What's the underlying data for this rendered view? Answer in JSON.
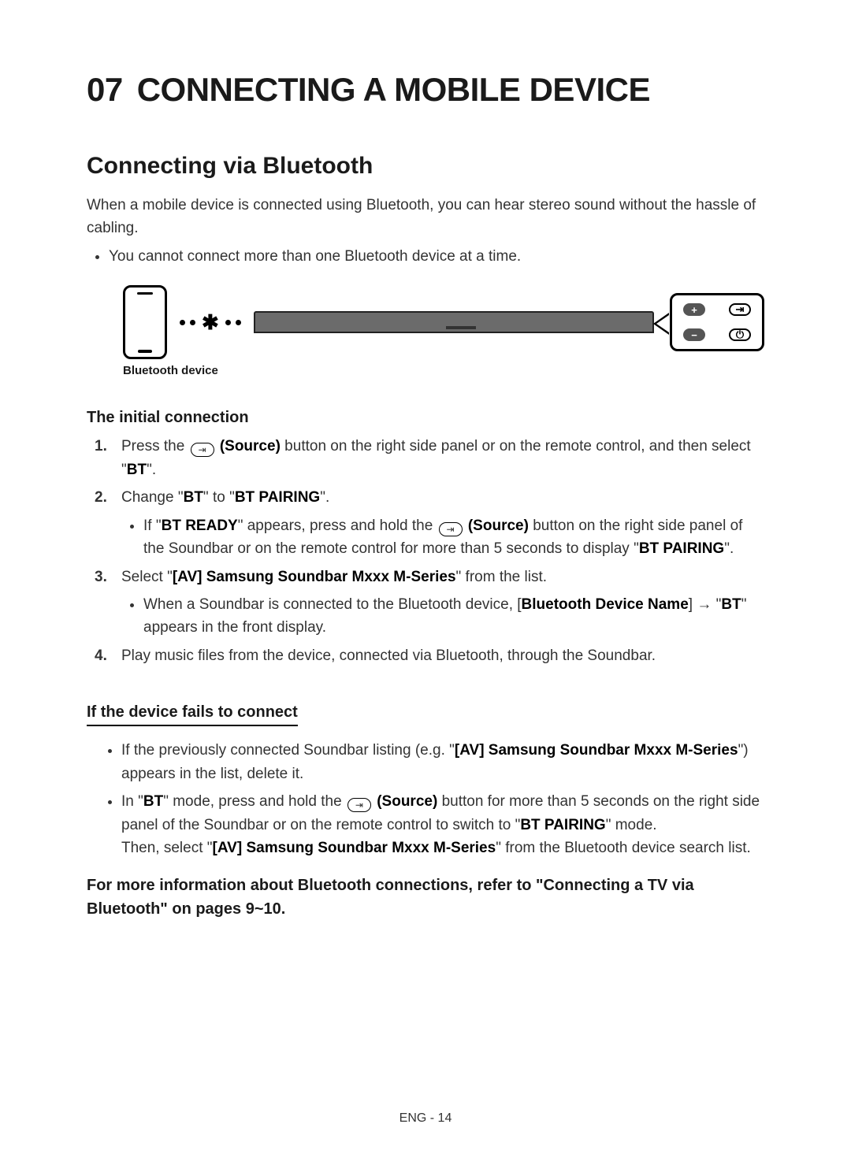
{
  "chapter": {
    "num": "07",
    "title": "CONNECTING A MOBILE DEVICE"
  },
  "section_title": "Connecting via Bluetooth",
  "intro": "When a mobile device is connected using Bluetooth, you can hear stereo sound without the hassle of cabling.",
  "intro_bullet": "You cannot connect more than one Bluetooth device at a time.",
  "illus_caption": "Bluetooth device",
  "h3_initial": "The initial connection",
  "steps": {
    "s1": {
      "num": "1.",
      "a": "Press the ",
      "b": " (Source)",
      "c": " button on the right side panel or on the remote control, and then select \"",
      "d": "BT",
      "e": "\"."
    },
    "s2": {
      "num": "2.",
      "a": "Change \"",
      "b": "BT",
      "c": "\" to \"",
      "d": "BT PAIRING",
      "e": "\".",
      "sub": {
        "a": "If \"",
        "b": "BT READY",
        "c": "\" appears, press and hold the ",
        "d": " (Source)",
        "e": " button on the right side panel of the Soundbar or on the remote control for more than 5 seconds to display \"",
        "f": "BT PAIRING",
        "g": "\"."
      }
    },
    "s3": {
      "num": "3.",
      "a": "Select \"",
      "b": "[AV] Samsung Soundbar Mxxx M-Series",
      "c": "\" from the list.",
      "sub": {
        "a": "When a Soundbar is connected to the Bluetooth device, [",
        "b": "Bluetooth Device Name",
        "c": "] → \"",
        "d": "BT",
        "e": "\" appears in the front display."
      }
    },
    "s4": {
      "num": "4.",
      "text": "Play music files from the device, connected via Bluetooth, through the Soundbar."
    }
  },
  "h3_fail": "If the device fails to connect",
  "fail": {
    "b1": {
      "a": "If the previously connected Soundbar listing (e.g. \"",
      "b": "[AV] Samsung Soundbar Mxxx M-Series",
      "c": "\") appears in the list, delete it."
    },
    "b2": {
      "a": "In \"",
      "b": "BT",
      "c": "\" mode, press and hold the ",
      "d": " (Source)",
      "e": " button for more than 5 seconds on the right side panel of the Soundbar or on the remote control to switch to \"",
      "f": "BT PAIRING",
      "g": "\" mode.",
      "h": "Then, select \"",
      "i": "[AV] Samsung Soundbar Mxxx M-Series",
      "j": "\" from the Bluetooth device search list."
    }
  },
  "more_info": "For more information about Bluetooth connections, refer to \"Connecting a TV via Bluetooth\" on pages 9~10.",
  "footer": "ENG - 14"
}
